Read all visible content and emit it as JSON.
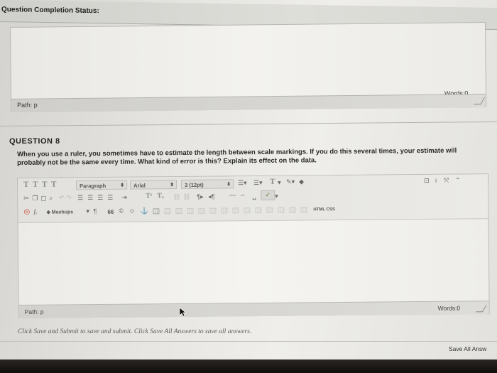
{
  "status": {
    "label": "Question Completion Status:"
  },
  "prev_editor": {
    "path": "Path: p",
    "words": "Words:0"
  },
  "question": {
    "title": "QUESTION 8",
    "text": "When you use a ruler, you sometimes have to estimate the length between scale markings. If you do this several times, your estimate will probably not be the same every time. What kind of error is this? Explain its effect on the data."
  },
  "toolbar": {
    "row1": {
      "format_buttons": [
        "T",
        "T",
        "T",
        "T"
      ],
      "paragraph": "Paragraph",
      "font": "Arial",
      "size": "3 (12pt)"
    },
    "row3": {
      "mashups": "Mashups",
      "paragraph_mark": "¶",
      "quote": "66",
      "html_css": "HTML CSS"
    }
  },
  "editor": {
    "path": "Path: p",
    "words": "Words:0"
  },
  "footer": {
    "instructions": "Click Save and Submit to save and submit. Click Save All Answers to save all answers.",
    "save_all": "Save All Answ"
  },
  "colors": {
    "background": "#e6e5e1",
    "record": "#c9463d",
    "spell_check": "#6a8a3a"
  }
}
